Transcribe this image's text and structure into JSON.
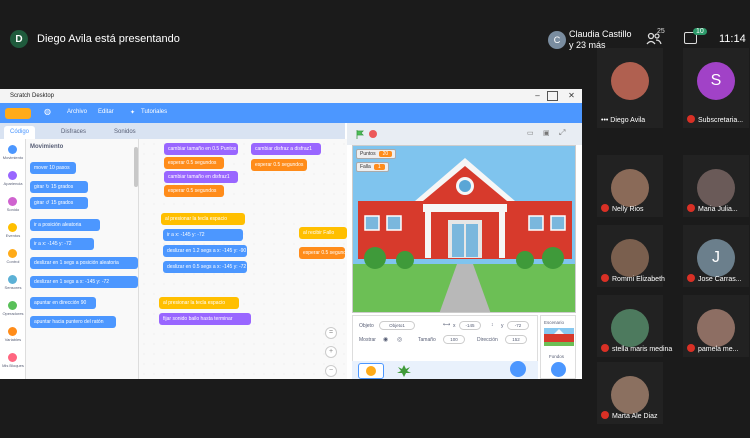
{
  "presenter": {
    "initial": "D",
    "text": "Diego Avila está presentando"
  },
  "header": {
    "chip_initial": "C",
    "chip_name": "Claudia Castillo",
    "chip_more": "y 23 más",
    "participants_count": "25",
    "chat_count": "10",
    "time": "11:14"
  },
  "scratch": {
    "window_title": "Scratch Desktop",
    "menu": {
      "archivo": "Archivo",
      "editar": "Editar",
      "tutoriales": "Tutoriales"
    },
    "tabs": {
      "codigo": "Código",
      "disfraces": "Disfraces",
      "sonidos": "Sonidos"
    },
    "categories": [
      "Movimiento",
      "Apariencia",
      "Sonido",
      "Eventos",
      "Control",
      "Sensores",
      "Operadores",
      "Variables",
      "Mis Bloques"
    ],
    "category_colors": [
      "#4c97ff",
      "#9966ff",
      "#cf63cf",
      "#ffbf00",
      "#ffab19",
      "#5cb1d6",
      "#59c059",
      "#ff8c1a",
      "#ff6680"
    ],
    "palette_header": "Movimiento",
    "palette_blocks": [
      "mover 10 pasos",
      "girar ↻ 15 grados",
      "girar ↺ 15 grados",
      "ir a posición aleatoria",
      "ir a x: -145 y: -72",
      "deslizar en 1 segs a posición aleatoria",
      "deslizar en 1 segs a x: -145 y: -72",
      "apuntar en dirección 90",
      "apuntar hacia puntero del ratón"
    ],
    "script_blocks": [
      "cambiar tamaño en 0.5 Puntos",
      "esperar 0.5 segundos",
      "cambiar tamaño en disfraz1",
      "esperar 0.5 segundos",
      "al presionar la tecla espacio",
      "ir a x: -145 y: -72",
      "deslizar en 1.2 segs a x: -145 y: -90",
      "deslizar en 0.5 segs a x: -145 y: -72",
      "al presionar la tecla espacio",
      "fijar sonido bailo hasta terminar",
      "cambiar disfraz a disfraz1",
      "esperar 0.5 segundos",
      "al recibir Fallo",
      "esperar 0.5 segundos"
    ],
    "variables": [
      {
        "name": "Puntos",
        "value": "20"
      },
      {
        "name": "Falla",
        "value": "1"
      }
    ],
    "sprite": {
      "label_objeto": "Objeto",
      "name": "Objeto1",
      "label_x": "x",
      "x": "-145",
      "label_y": "y",
      "y": "-72",
      "label_mostrar": "Mostrar",
      "label_tamano": "Tamaño",
      "size": "100",
      "label_direccion": "Dirección",
      "direction": "152"
    },
    "stage_label": "Escenario",
    "fondos_label": "Fondos"
  },
  "participants": [
    {
      "name": "Diego Avila",
      "muted": false,
      "kind": "photo",
      "color": "#b06050"
    },
    {
      "name": "Subscretaria...",
      "muted": true,
      "kind": "initial",
      "initial": "S",
      "color": "#a142c7"
    },
    {
      "name": "Nelly Rios",
      "muted": true,
      "kind": "photo",
      "color": "#8a6a58"
    },
    {
      "name": "Maria Julia...",
      "muted": true,
      "kind": "photo",
      "color": "#6a5a58"
    },
    {
      "name": "Rommi Elizabeth",
      "muted": true,
      "kind": "photo",
      "color": "#7a5f4e"
    },
    {
      "name": "Jose Carras...",
      "muted": true,
      "kind": "initial",
      "initial": "J",
      "color": "#6b7f8c"
    },
    {
      "name": "stella maris medina",
      "muted": true,
      "kind": "photo",
      "color": "#4d7a5e"
    },
    {
      "name": "pamela me...",
      "muted": true,
      "kind": "photo",
      "color": "#8d6e63"
    },
    {
      "name": "Marta Ale Diaz",
      "muted": true,
      "kind": "photo",
      "color": "#8b7060"
    }
  ]
}
